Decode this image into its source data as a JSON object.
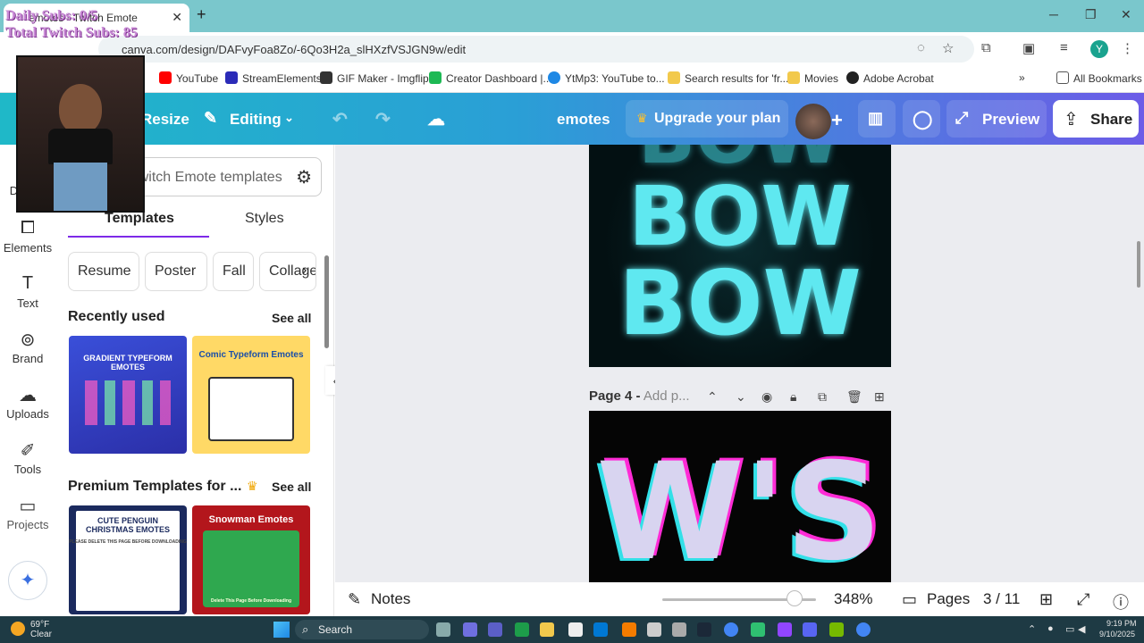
{
  "browser": {
    "tab_title": "emotes - Twitch Emote",
    "url": "canva.com/design/DAFvyFoa8Zo/-6Qo3H2a_slHXzfVSJGN9w/edit",
    "avatar_letter": "Y",
    "bookmarks": [
      "YouTube",
      "StreamElements",
      "GIF Maker - Imgflip",
      "Creator Dashboard |...",
      "YtMp3: YouTube to...",
      "Search results for 'fr...",
      "Movies",
      "Adobe Acrobat"
    ],
    "all_bookmarks": "All Bookmarks"
  },
  "overlay": {
    "daily_subs": "Daily Subs: 0/5",
    "total_subs": "Total Twitch Subs: 85"
  },
  "topbar": {
    "resize": "Resize",
    "editing": "Editing",
    "doc_title": "emotes",
    "upgrade": "Upgrade your plan",
    "preview": "Preview",
    "share": "Share"
  },
  "rail": {
    "design": "Design",
    "elements": "Elements",
    "text": "Text",
    "brand": "Brand",
    "uploads": "Uploads",
    "tools": "Tools",
    "projects": "Projects"
  },
  "panel": {
    "search_placeholder": "Search Twitch Emote templates",
    "tabs": [
      "Templates",
      "Styles"
    ],
    "chips": [
      "Resume",
      "Poster",
      "Fall",
      "Collage"
    ],
    "recent_title": "Recently used",
    "see_all": "See all",
    "premium_title": "Premium Templates for ...",
    "thumb1_caption": "GRADIENT TYPEFORM EMOTES",
    "thumb2_caption": "Comic Typeform Emotes",
    "thumb3_caption": "CUTE PENGUIN CHRISTMAS EMOTES",
    "thumb3_sub": "PLEASE DELETE THIS PAGE BEFORE DOWNLOADING",
    "thumb4_caption": "Snowman Emotes",
    "thumb4_sub": "Delete This Page Before Downloading"
  },
  "canvas": {
    "page3_text": [
      "BOW",
      "BOW",
      "BOW"
    ],
    "page4_label": "Page 4 -",
    "page4_placeholder": "Add p...",
    "page4_text": "W'S"
  },
  "bottombar": {
    "notes": "Notes",
    "zoom": "348%",
    "pages": "Pages",
    "page_count": "3 / 11"
  },
  "taskbar": {
    "weather_temp": "69°F",
    "weather_desc": "Clear",
    "search": "Search",
    "time": "9:19 PM",
    "date": "9/10/2025"
  },
  "colors": {
    "accent_purple": "#7d2ae8",
    "topbar_start": "#1fb8c8",
    "topbar_end": "#6c5ce7",
    "cyan_glow": "#5fe8f0",
    "magenta": "#ff2bd6"
  }
}
